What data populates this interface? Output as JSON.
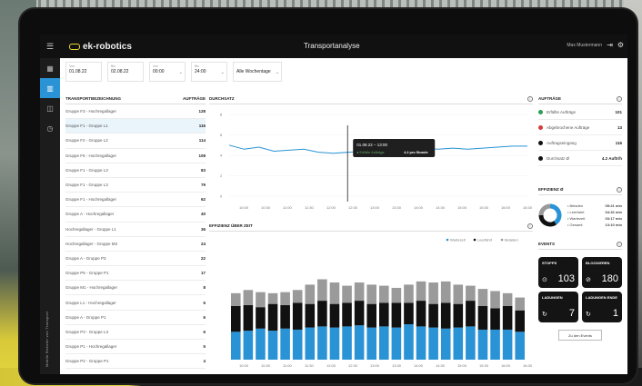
{
  "header": {
    "app_name": "ek-robotics",
    "title": "Transportanalyse",
    "user": "Max Mustermann"
  },
  "filters": [
    {
      "label": "Von",
      "value": "01.08.22"
    },
    {
      "label": "Bis",
      "value": "02.08.22"
    },
    {
      "label": "Von",
      "value": "00:00"
    },
    {
      "label": "Bis",
      "value": "24:00"
    },
    {
      "label": "Schicht",
      "value": "Alle Wochentage"
    }
  ],
  "left": {
    "col1": "Transportbezeichnung",
    "col2": "Aufträge",
    "rows": [
      {
        "name": "Gruppe F3 - Hochregallager",
        "value": "128"
      },
      {
        "name": "Gruppe F1 - Gruppe L1",
        "value": "116"
      },
      {
        "name": "Gruppe F2 - Gruppe L2",
        "value": "114"
      },
      {
        "name": "Gruppe F5 - Hochregallager",
        "value": "108"
      },
      {
        "name": "Gruppe F1 - Gruppe L3",
        "value": "83"
      },
      {
        "name": "Gruppe F1 - Gruppe L3",
        "value": "79"
      },
      {
        "name": "Gruppe F1 - Hochregallager",
        "value": "62"
      },
      {
        "name": "Gruppe A - Hochregallager",
        "value": "40"
      },
      {
        "name": "Hochregallager - Gruppe L1",
        "value": "36"
      },
      {
        "name": "Hochregallager - Gruppe M3",
        "value": "24"
      },
      {
        "name": "Gruppe A - Gruppe P3",
        "value": "22"
      },
      {
        "name": "Gruppe P5 - Gruppe P1",
        "value": "17"
      },
      {
        "name": "Gruppe M1 - Hochregallager",
        "value": "8"
      },
      {
        "name": "Gruppe L1 - Hochregallager",
        "value": "6"
      },
      {
        "name": "Gruppe A - Gruppe P1",
        "value": "6"
      },
      {
        "name": "Gruppe P3 - Gruppe L3",
        "value": "6"
      },
      {
        "name": "Gruppe P1 - Hochregallager",
        "value": "5"
      },
      {
        "name": "Gruppe P2 - Gruppe P1",
        "value": "4"
      }
    ]
  },
  "throughput": {
    "title": "Durchsatz",
    "tooltip_date": "01.08.22 – 13:00",
    "tooltip_label": "Erfüllte Aufträge",
    "tooltip_value": "4.2 pro Stunde"
  },
  "efficiency_chart": {
    "title": "Effizienz über Zeit",
    "legend": [
      "Wartezeit",
      "Leerfahrt",
      "Beladen"
    ]
  },
  "chart_data": [
    {
      "type": "line",
      "title": "Durchsatz",
      "x": [
        "10:00",
        "10:30",
        "11:00",
        "11:30",
        "12:00",
        "12:30",
        "13:00",
        "13:30",
        "14:00",
        "14:30",
        "15:00",
        "15:30",
        "16:00",
        "16:30"
      ],
      "y": [
        5.0,
        4.6,
        4.8,
        4.4,
        4.5,
        4.6,
        4.3,
        4.2,
        4.3,
        4.4,
        4.5,
        4.8,
        4.9,
        4.7,
        4.6,
        4.7,
        4.6,
        4.7,
        4.8,
        4.9,
        4.9
      ],
      "ylim": [
        0,
        8
      ],
      "yticks": [
        "8",
        "6",
        "4",
        "2",
        "0"
      ],
      "color": "#2a93d5"
    },
    {
      "type": "bar",
      "title": "Effizienz über Zeit",
      "categories": [
        "10:00",
        "10:30",
        "11:00",
        "11:30",
        "12:00",
        "12:30",
        "13:00",
        "13:30",
        "14:00",
        "14:30",
        "15:00",
        "15:30",
        "16:00",
        "16:30"
      ],
      "series": [
        {
          "name": "Beladen",
          "color": "#2a93d5",
          "values": [
            26,
            27,
            29,
            27,
            29,
            28,
            30,
            31,
            30,
            31,
            32,
            30,
            31,
            30,
            33,
            31,
            30,
            29,
            30,
            31,
            28,
            28,
            28,
            26
          ]
        },
        {
          "name": "Leerfahrt",
          "color": "#111111",
          "values": [
            24,
            24,
            20,
            25,
            22,
            25,
            22,
            24,
            22,
            22,
            23,
            22,
            22,
            23,
            20,
            24,
            22,
            24,
            22,
            24,
            22,
            20,
            22,
            20
          ]
        },
        {
          "name": "Wartezeit",
          "color": "#9a9a9a",
          "values": [
            12,
            14,
            14,
            10,
            12,
            12,
            18,
            20,
            20,
            16,
            17,
            18,
            16,
            14,
            17,
            18,
            20,
            20,
            18,
            14,
            16,
            16,
            12,
            12
          ]
        }
      ],
      "ylim": [
        0,
        100
      ]
    }
  ],
  "orders": {
    "title": "Aufträge",
    "items": [
      {
        "label": "Erfüllte Aufträge",
        "value": "101",
        "color": "#2e9e50"
      },
      {
        "label": "Abgebrochene Aufträge",
        "value": "13",
        "color": "#d63b3b"
      },
      {
        "label": "Auftragseingang",
        "value": "116",
        "color": "#111111"
      },
      {
        "label": "Durchsatz Ø",
        "value": "4.2 Auftr/h",
        "color": "#111111"
      }
    ]
  },
  "efficiency": {
    "title": "Effizienz Ø",
    "items": [
      {
        "label": "Beladen",
        "value": "05:21 min",
        "color": "#2a93d5"
      },
      {
        "label": "Leerfahrt",
        "value": "04:32 min",
        "color": "#111111"
      },
      {
        "label": "Wartezeit",
        "value": "03:17 min",
        "color": "#9a9a9a"
      },
      {
        "label": "Gesamt",
        "value": "13:10 min",
        "color": "#ffffff"
      }
    ]
  },
  "events": {
    "title": "Events",
    "cards": [
      {
        "label": "Stopps",
        "value": "103",
        "icon": "⊙"
      },
      {
        "label": "Blockieren",
        "value": "180",
        "icon": "⊘"
      },
      {
        "label": "Ladungen",
        "value": "7",
        "icon": "↻"
      },
      {
        "label": "Ladungen Ende",
        "value": "1",
        "icon": "↻"
      }
    ],
    "button": "Zu den Events"
  },
  "sidebar": {
    "footer_text": "Mobile Roboter von Transport"
  }
}
